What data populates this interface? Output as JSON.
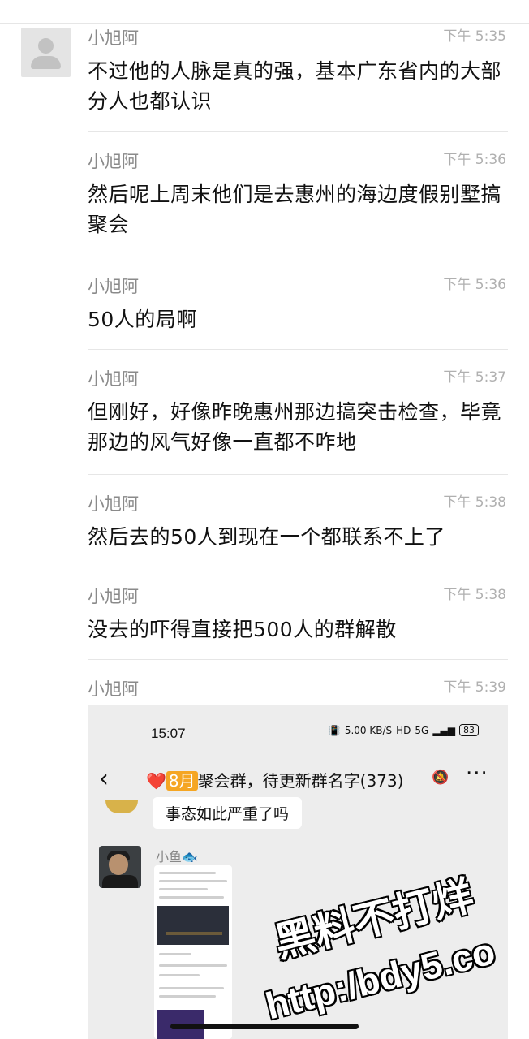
{
  "messages": [
    {
      "sender": "小旭阿",
      "time": "下午 5:35",
      "text": "不过他的人脉是真的强，基本广东省内的大部分人也都认识"
    },
    {
      "sender": "小旭阿",
      "time": "下午 5:36",
      "text": "然后呢上周末他们是去惠州的海边度假别墅搞聚会"
    },
    {
      "sender": "小旭阿",
      "time": "下午 5:36",
      "text": "50人的局啊"
    },
    {
      "sender": "小旭阿",
      "time": "下午 5:37",
      "text": "但刚好，好像昨晚惠州那边搞突击检查，毕竟那边的风气好像一直都不咋地"
    },
    {
      "sender": "小旭阿",
      "time": "下午 5:38",
      "text": "然后去的50人到现在一个都联系不上了"
    },
    {
      "sender": "小旭阿",
      "time": "下午 5:38",
      "text": "没去的吓得直接把500人的群解散"
    },
    {
      "sender": "小旭阿",
      "time": "下午 5:39",
      "text": ""
    }
  ],
  "screenshot": {
    "status_time": "15:07",
    "net_speed": "5.00 KB/S",
    "hd": "HD",
    "signal": "5G",
    "battery": "83",
    "heart": "❤️",
    "month_badge": "8月",
    "chat_title": "聚会群，待更新群名字(373)",
    "bubble_text": "事态如此严重了吗",
    "second_sender": "小鱼",
    "fish_emoji": "🐟"
  },
  "watermark": {
    "line1": "黑料不打烊",
    "line2": "http:/bdy5.co"
  }
}
